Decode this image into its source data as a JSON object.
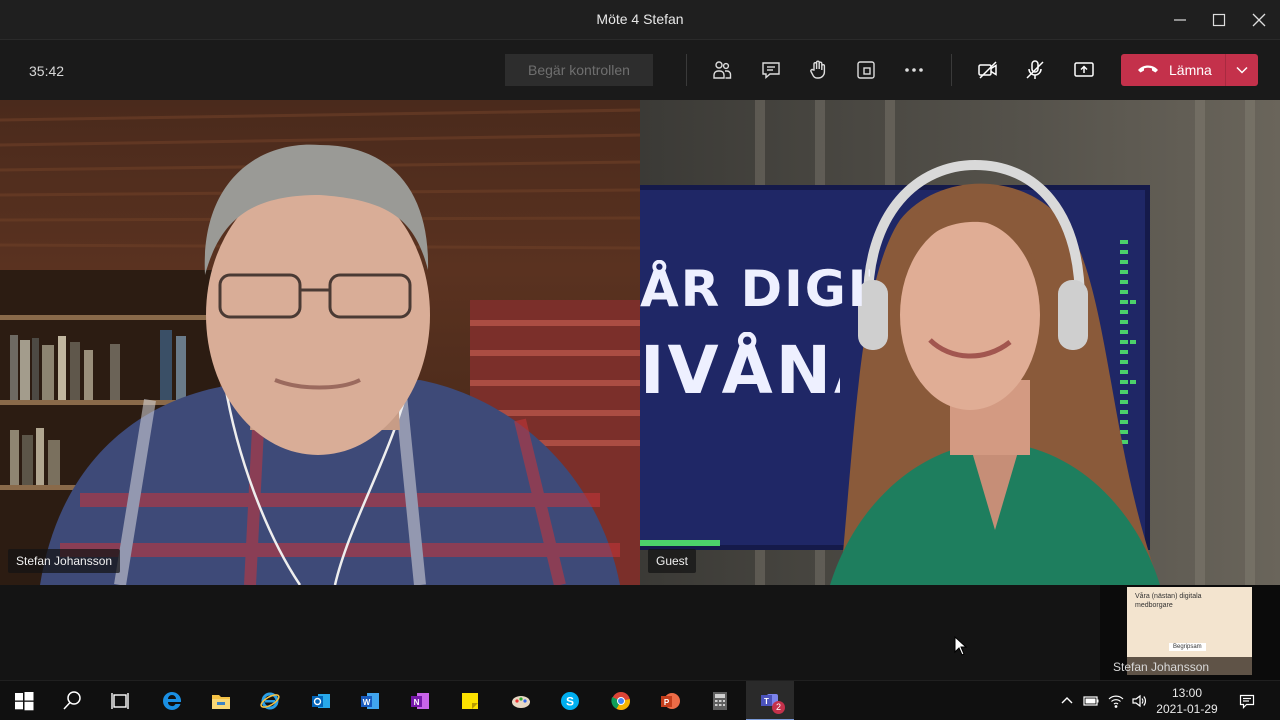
{
  "window": {
    "title": "Möte 4 Stefan"
  },
  "toolbar": {
    "timer": "35:42",
    "request_control_label": "Begär kontrollen",
    "leave_label": "Lämna"
  },
  "participants": [
    {
      "name": "Stefan Johansson"
    },
    {
      "name": "Guest"
    }
  ],
  "background_sign": {
    "line1": "ÅR DIGITA",
    "line2": "IVÅNA"
  },
  "self_view": {
    "name": "Stefan Johansson",
    "slide_title_1": "Våra (nästan) digitala",
    "slide_title_2": "medborgare",
    "slide_logo": "Begripsam"
  },
  "taskbar": {
    "time": "13:00",
    "date": "2021-01-29",
    "teams_badge": "2",
    "apps": [
      "windows-start",
      "search",
      "task-view",
      "edge",
      "file-explorer",
      "internet-explorer",
      "outlook",
      "word",
      "onenote",
      "sticky-notes",
      "paint",
      "skype",
      "chrome",
      "powerpoint",
      "calculator",
      "teams"
    ]
  },
  "colors": {
    "leave_red": "#c4314b",
    "bar_bg": "#1a1a1a",
    "title_bg": "#1f1f1f"
  }
}
